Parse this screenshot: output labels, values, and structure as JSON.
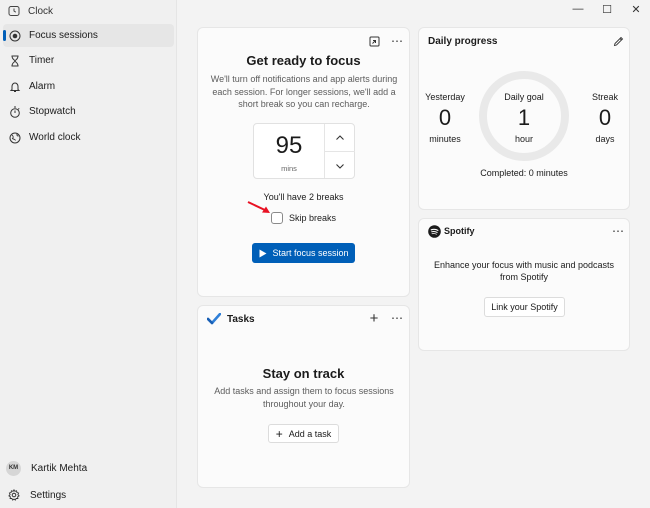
{
  "app": {
    "title": "Clock"
  },
  "window_controls": {
    "minimize": "—",
    "maximize": "☐",
    "close": "✕"
  },
  "sidebar": {
    "items": [
      {
        "label": "Focus sessions",
        "icon": "focus-icon",
        "selected": true
      },
      {
        "label": "Timer",
        "icon": "hourglass-icon",
        "selected": false
      },
      {
        "label": "Alarm",
        "icon": "bell-icon",
        "selected": false
      },
      {
        "label": "Stopwatch",
        "icon": "stopwatch-icon",
        "selected": false
      },
      {
        "label": "World clock",
        "icon": "globe-icon",
        "selected": false
      }
    ],
    "user": {
      "initials": "KM",
      "name": "Kartik Mehta"
    },
    "settings_label": "Settings"
  },
  "focus": {
    "title": "Get ready to focus",
    "description": "We'll turn off notifications and app alerts during each session. For longer sessions, we'll add a short break so you can recharge.",
    "minutes_value": "95",
    "minutes_unit": "mins",
    "breaks_text": "You'll have 2 breaks",
    "skip_breaks_label": "Skip breaks",
    "skip_breaks_checked": false,
    "start_label": "Start focus session"
  },
  "tasks": {
    "header": "Tasks",
    "title": "Stay on track",
    "description": "Add tasks and assign them to focus sessions throughout your day.",
    "add_label": "Add a task"
  },
  "daily_progress": {
    "title": "Daily progress",
    "yesterday": {
      "label": "Yesterday",
      "value": "0",
      "unit": "minutes"
    },
    "goal": {
      "label": "Daily goal",
      "value": "1",
      "unit": "hour"
    },
    "streak": {
      "label": "Streak",
      "value": "0",
      "unit": "days"
    },
    "completed_text": "Completed: 0 minutes",
    "progress_fraction": 0
  },
  "spotify": {
    "brand": "Spotify",
    "description": "Enhance your focus with music and podcasts from Spotify",
    "link_label": "Link your Spotify"
  },
  "colors": {
    "accent": "#005fb8",
    "annotation_arrow": "#e81123"
  }
}
